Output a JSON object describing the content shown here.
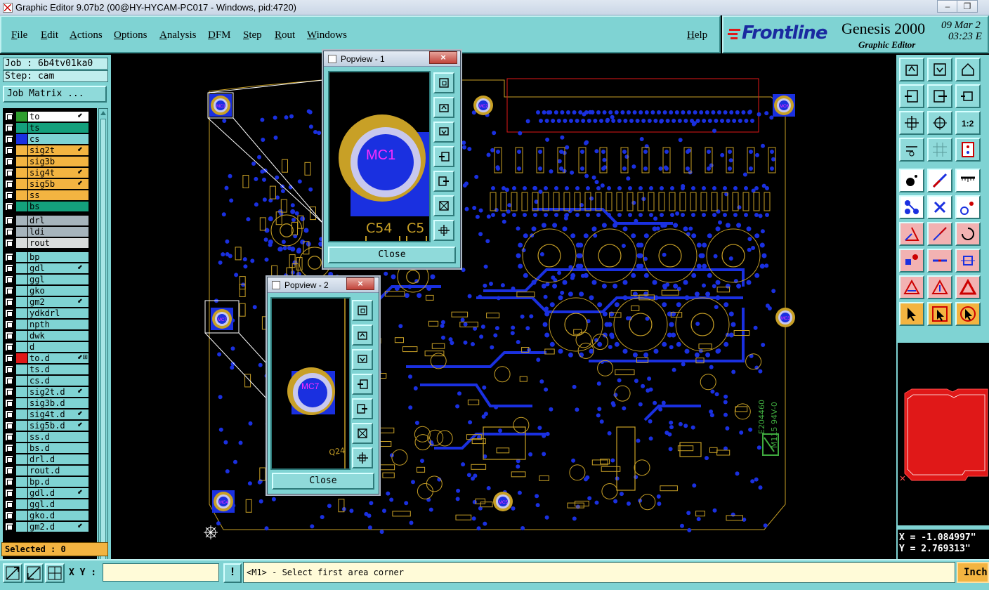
{
  "window": {
    "title": "Graphic Editor 9.07b2 (00@HY-HYCAM-PC017 - Windows, pid:4720)",
    "minimize": "–",
    "maximize": "❐"
  },
  "menu": {
    "items": [
      "File",
      "Edit",
      "Actions",
      "Options",
      "Analysis",
      "DFM",
      "Step",
      "Rout",
      "Windows"
    ],
    "help": "Help"
  },
  "brand": {
    "logo": "Frontline",
    "product": "Genesis 2000",
    "subtitle": "Graphic Editor",
    "date": "09 Mar 2",
    "time": "03:23 E"
  },
  "job": {
    "job_label": "Job : 6b4tv01ka0",
    "step_label": "Step: cam",
    "matrix_button": "Job Matrix ..."
  },
  "layers": [
    {
      "name": "to",
      "color": "#ffffff",
      "swatch": "#2e9e2e",
      "mark": "⬋"
    },
    {
      "name": "ts",
      "color": "#14a07c",
      "swatch": "",
      "mark": ""
    },
    {
      "name": "cs",
      "color": "#7fd3d3",
      "swatch": "#1a30e0",
      "mark": ""
    },
    {
      "name": "sig2t",
      "color": "#f3b441",
      "swatch": "",
      "mark": "⬋"
    },
    {
      "name": "sig3b",
      "color": "#f3b441",
      "swatch": "",
      "mark": ""
    },
    {
      "name": "sig4t",
      "color": "#f3b441",
      "swatch": "",
      "mark": "⬋"
    },
    {
      "name": "sig5b",
      "color": "#f3b441",
      "swatch": "",
      "mark": "⬋"
    },
    {
      "name": "ss",
      "color": "#f3b441",
      "swatch": "",
      "mark": ""
    },
    {
      "name": "bs",
      "color": "#14a07c",
      "swatch": "",
      "mark": ""
    },
    {
      "name": "drl",
      "color": "#a6b4bc",
      "swatch": "",
      "mark": ""
    },
    {
      "name": "ldi",
      "color": "#a6b4bc",
      "swatch": "",
      "mark": ""
    },
    {
      "name": "rout",
      "color": "#d9dcdc",
      "swatch": "",
      "mark": ""
    },
    {
      "name": "bp",
      "color": "#7fd3d3",
      "swatch": "",
      "mark": ""
    },
    {
      "name": "gdl",
      "color": "#7fd3d3",
      "swatch": "",
      "mark": "⬋"
    },
    {
      "name": "ggl",
      "color": "#7fd3d3",
      "swatch": "",
      "mark": ""
    },
    {
      "name": "gko",
      "color": "#7fd3d3",
      "swatch": "",
      "mark": ""
    },
    {
      "name": "gm2",
      "color": "#7fd3d3",
      "swatch": "",
      "mark": "⬋"
    },
    {
      "name": "ydkdrl",
      "color": "#7fd3d3",
      "swatch": "",
      "mark": ""
    },
    {
      "name": "npth",
      "color": "#7fd3d3",
      "swatch": "",
      "mark": ""
    },
    {
      "name": "dwk",
      "color": "#7fd3d3",
      "swatch": "",
      "mark": ""
    },
    {
      "name": "d",
      "color": "#7fd3d3",
      "swatch": "",
      "mark": ""
    },
    {
      "name": "to.d",
      "color": "#7fd3d3",
      "swatch": "#e01818",
      "mark": "⬋⊞"
    },
    {
      "name": "ts.d",
      "color": "#7fd3d3",
      "swatch": "",
      "mark": ""
    },
    {
      "name": "cs.d",
      "color": "#7fd3d3",
      "swatch": "",
      "mark": ""
    },
    {
      "name": "sig2t.d",
      "color": "#7fd3d3",
      "swatch": "",
      "mark": "⬋"
    },
    {
      "name": "sig3b.d",
      "color": "#7fd3d3",
      "swatch": "",
      "mark": ""
    },
    {
      "name": "sig4t.d",
      "color": "#7fd3d3",
      "swatch": "",
      "mark": "⬋"
    },
    {
      "name": "sig5b.d",
      "color": "#7fd3d3",
      "swatch": "",
      "mark": "⬋"
    },
    {
      "name": "ss.d",
      "color": "#7fd3d3",
      "swatch": "",
      "mark": ""
    },
    {
      "name": "bs.d",
      "color": "#7fd3d3",
      "swatch": "",
      "mark": ""
    },
    {
      "name": "drl.d",
      "color": "#7fd3d3",
      "swatch": "",
      "mark": ""
    },
    {
      "name": "rout.d",
      "color": "#7fd3d3",
      "swatch": "",
      "mark": ""
    },
    {
      "name": "bp.d",
      "color": "#7fd3d3",
      "swatch": "",
      "mark": ""
    },
    {
      "name": "gdl.d",
      "color": "#7fd3d3",
      "swatch": "",
      "mark": "⬋"
    },
    {
      "name": "ggl.d",
      "color": "#7fd3d3",
      "swatch": "",
      "mark": ""
    },
    {
      "name": "gko.d",
      "color": "#7fd3d3",
      "swatch": "",
      "mark": ""
    },
    {
      "name": "gm2.d",
      "color": "#7fd3d3",
      "swatch": "",
      "mark": "⬋"
    }
  ],
  "selected": "Selected : 0",
  "canvas": {
    "labels": [
      "MC1",
      "MC2",
      "MC3",
      "MC4",
      "MC5",
      "MC6",
      "MC7"
    ],
    "board_text": [
      "E204460",
      "M115 94V-0"
    ]
  },
  "popview1": {
    "title": "Popview - 1",
    "pad_label": "MC1",
    "ref_labels": [
      "C54",
      "C5"
    ],
    "close": "Close",
    "close_icon": "×"
  },
  "popview2": {
    "title": "Popview - 2",
    "pad_label": "MC7",
    "ref_label": "Q24",
    "close": "Close",
    "close_icon": "×"
  },
  "coords": {
    "x": "X = -1.084997\"",
    "y": "Y = 2.769313\""
  },
  "status": {
    "xy_label": "X Y :",
    "xy_value": "",
    "prompt_icon": "!",
    "prompt": "<M1> - Select first area corner",
    "units": "Inch"
  },
  "colors": {
    "panel": "#7fd3d3",
    "top_copper": "#1a30e0",
    "silkscreen": "#c8a026",
    "highlight": "#f3b441",
    "board_outline": "#e01818"
  }
}
